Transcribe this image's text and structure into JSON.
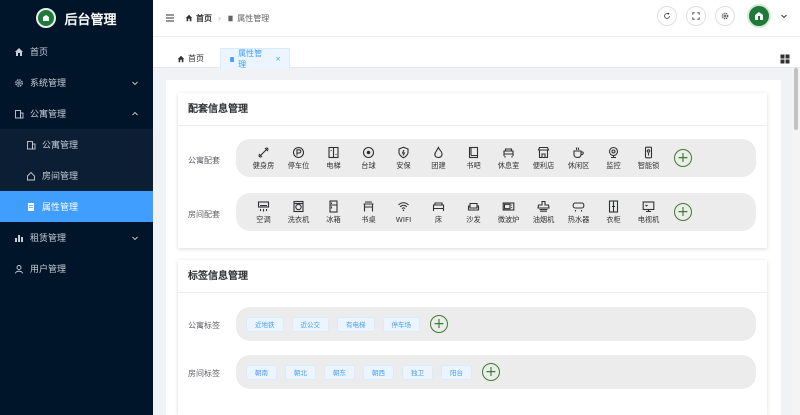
{
  "app": {
    "title": "后台管理"
  },
  "sidebar": {
    "items": [
      {
        "label": "首页"
      },
      {
        "label": "系统管理"
      },
      {
        "label": "公寓管理"
      },
      {
        "label": "公寓管理"
      },
      {
        "label": "房间管理"
      },
      {
        "label": "属性管理"
      },
      {
        "label": "租赁管理"
      },
      {
        "label": "用户管理"
      }
    ]
  },
  "header": {
    "breadcrumb": {
      "home": "首页",
      "current": "属性管理"
    }
  },
  "tabs": [
    {
      "label": "首页"
    },
    {
      "label": "属性管理",
      "close": "×"
    }
  ],
  "facility_card": {
    "title": "配套信息管理",
    "apartment_label": "公寓配套",
    "apartment_items": [
      {
        "label": "健身房",
        "icon": "dumbbell-icon"
      },
      {
        "label": "停车位",
        "icon": "parking-icon"
      },
      {
        "label": "电梯",
        "icon": "elevator-icon"
      },
      {
        "label": "台球",
        "icon": "billiards-icon"
      },
      {
        "label": "安保",
        "icon": "security-icon"
      },
      {
        "label": "团建",
        "icon": "fire-icon"
      },
      {
        "label": "书吧",
        "icon": "book-icon"
      },
      {
        "label": "休息室",
        "icon": "lounge-icon"
      },
      {
        "label": "便利店",
        "icon": "store-icon"
      },
      {
        "label": "休闲区",
        "icon": "coffee-icon"
      },
      {
        "label": "监控",
        "icon": "camera-icon"
      },
      {
        "label": "智能锁",
        "icon": "smart-lock-icon"
      }
    ],
    "room_label": "房间配套",
    "room_items": [
      {
        "label": "空调",
        "icon": "air-conditioner-icon"
      },
      {
        "label": "洗衣机",
        "icon": "washing-machine-icon"
      },
      {
        "label": "冰箱",
        "icon": "fridge-icon"
      },
      {
        "label": "书桌",
        "icon": "desk-icon"
      },
      {
        "label": "WIFI",
        "icon": "wifi-icon"
      },
      {
        "label": "床",
        "icon": "bed-icon"
      },
      {
        "label": "沙发",
        "icon": "sofa-icon"
      },
      {
        "label": "微波炉",
        "icon": "microwave-icon"
      },
      {
        "label": "油烟机",
        "icon": "range-hood-icon"
      },
      {
        "label": "热水器",
        "icon": "water-heater-icon"
      },
      {
        "label": "衣柜",
        "icon": "wardrobe-icon"
      },
      {
        "label": "电视机",
        "icon": "tv-icon"
      }
    ],
    "add_symbol": "+"
  },
  "tag_card": {
    "title": "标签信息管理",
    "apartment_label": "公寓标签",
    "apartment_tags": [
      "近地铁",
      "近公交",
      "有电梯",
      "停车场"
    ],
    "room_label": "房间标签",
    "room_tags": [
      "朝南",
      "朝北",
      "朝东",
      "朝西",
      "独卫",
      "阳台"
    ],
    "add_symbol": "+"
  },
  "colors": {
    "sidebar_bg": "#001529",
    "accent": "#409eff",
    "add_green": "#3a7d2c",
    "logo_green": "#1f7a3a"
  }
}
